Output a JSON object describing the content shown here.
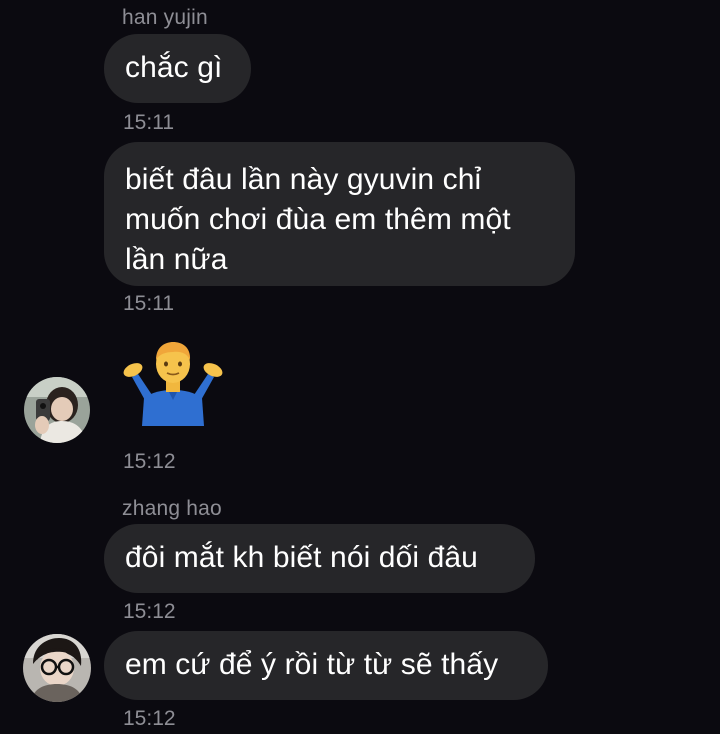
{
  "messages": [
    {
      "sender": "han yujin",
      "text": "chắc gì",
      "time": "15:11"
    },
    {
      "text": "biết đâu lần này gyuvin chỉ muốn chơi đùa em thêm một lần nữa",
      "line1": "biết đâu lần này gyuvin chỉ",
      "line2": "muốn chơi đùa em thêm một",
      "line3": "lần nữa",
      "time": "15:11"
    },
    {
      "emoji": "person-shrugging-icon",
      "time": "15:12"
    },
    {
      "sender": "zhang hao",
      "text": "đôi mắt kh biết nói dối đâu",
      "time": "15:12"
    },
    {
      "text": "em cứ để ý rồi từ từ sẽ thấy",
      "time": "15:12"
    }
  ],
  "colors": {
    "background": "#0b0a10",
    "bubble": "#262629",
    "meta_text": "#8e8e95",
    "message_text": "#ffffff"
  }
}
